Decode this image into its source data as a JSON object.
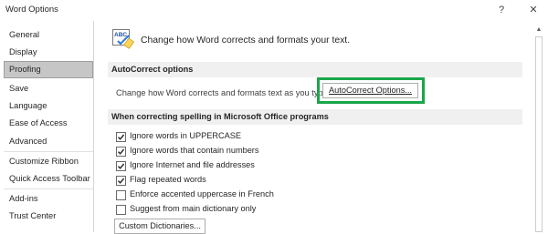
{
  "window": {
    "title": "Word Options",
    "help": "?",
    "close": "✕"
  },
  "sidebar": {
    "items": [
      {
        "label": "General",
        "selected": false
      },
      {
        "label": "Display",
        "selected": false
      },
      {
        "label": "Proofing",
        "selected": true
      },
      {
        "label": "Save",
        "selected": false
      },
      {
        "label": "Language",
        "selected": false
      },
      {
        "label": "Ease of Access",
        "selected": false
      },
      {
        "label": "Advanced",
        "selected": false
      },
      {
        "label": "Customize Ribbon",
        "selected": false
      },
      {
        "label": "Quick Access Toolbar",
        "selected": false
      },
      {
        "label": "Add-ins",
        "selected": false
      },
      {
        "label": "Trust Center",
        "selected": false
      }
    ]
  },
  "header": {
    "text": "Change how Word corrects and formats your text.",
    "icon": "abc-check-icon"
  },
  "autocorrect": {
    "section_title": "AutoCorrect options",
    "description": "Change how Word corrects and formats text as you type:",
    "button_label": "AutoCorrect Options...",
    "highlight_color": "#1aa64a"
  },
  "spelling": {
    "section_title": "When correcting spelling in Microsoft Office programs",
    "options": [
      {
        "label": "Ignore words in UPPERCASE",
        "checked": true
      },
      {
        "label": "Ignore words that contain numbers",
        "checked": true
      },
      {
        "label": "Ignore Internet and file addresses",
        "checked": true
      },
      {
        "label": "Flag repeated words",
        "checked": true
      },
      {
        "label": "Enforce accented uppercase in French",
        "checked": false
      },
      {
        "label": "Suggest from main dictionary only",
        "checked": false
      }
    ],
    "dictionaries_button": "Custom Dictionaries..."
  },
  "colors": {
    "selected_nav_bg": "#c6c6c6",
    "section_bg": "#f0f0f0",
    "accent_check": "#1aa64a"
  }
}
